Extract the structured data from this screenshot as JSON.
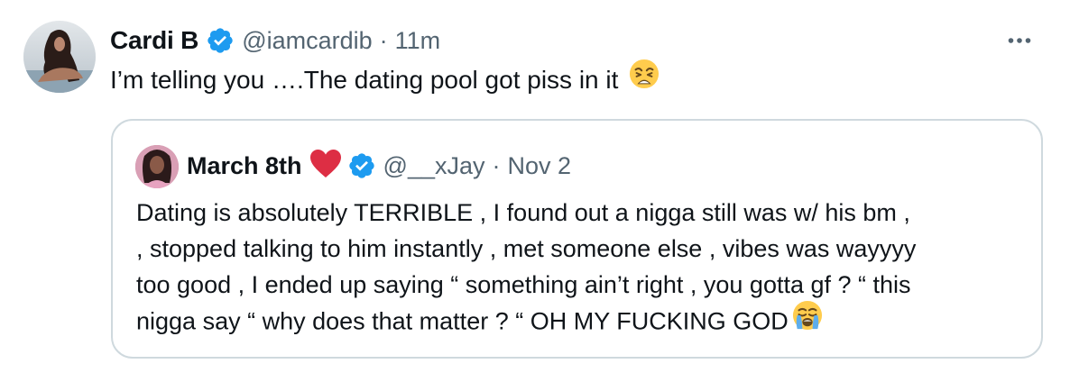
{
  "tweet": {
    "author": {
      "name": "Cardi B",
      "handle": "@iamcardib",
      "separator": "·",
      "time": "11m",
      "verified": true
    },
    "text": "I’m telling you ….The dating pool got piss in it",
    "emoji": "weary-face",
    "more_icon": "more-horizontal-icon"
  },
  "quote": {
    "author": {
      "name": "March 8th",
      "handle": "@__xJay",
      "separator": "·",
      "time": "Nov 2",
      "verified": true,
      "name_emoji": "red-heart"
    },
    "lines": [
      "Dating is absolutely TERRIBLE , I found out a nigga still was w/ his bm ,",
      ", stopped talking to him instantly , met someone else , vibes was wayyyy",
      "too good , I ended up saying “ something ain’t right , you gotta gf ? “ this",
      "nigga say “ why does that matter ? “ OH MY FUCKING GOD"
    ],
    "end_emoji": "loudly-crying-face"
  },
  "colors": {
    "verified_blue": "#1d9bf0",
    "secondary_text": "#536471",
    "border": "#cfd9de",
    "heart_red": "#e0245e"
  }
}
